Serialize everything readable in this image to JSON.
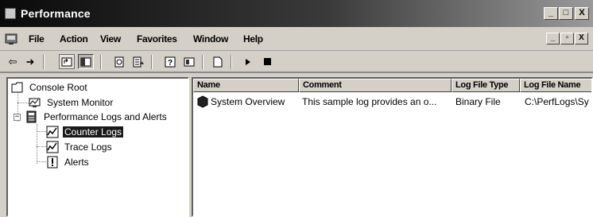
{
  "window": {
    "title": "Performance",
    "minimize": "_",
    "maximize": "□",
    "close": "X"
  },
  "menu": {
    "items": [
      "File",
      "Action",
      "View",
      "Favorites",
      "Window",
      "Help"
    ],
    "doc_minimize": "_",
    "doc_restore": "▫",
    "doc_close": "X"
  },
  "toolbar": {
    "buttons": [
      "back-icon",
      "forward-icon",
      "up-one-level-icon",
      "show-hide-console-tree-icon",
      "refresh-icon",
      "export-list-icon",
      "help-icon",
      "console-tree-icon",
      "new-log-settings-icon",
      "start-icon",
      "stop-icon"
    ]
  },
  "tree": {
    "root": "Console Root",
    "system_monitor": "System Monitor",
    "perf_logs": "Performance Logs and Alerts",
    "counter_logs": "Counter Logs",
    "trace_logs": "Trace Logs",
    "alerts": "Alerts",
    "expander": "−"
  },
  "list": {
    "columns": [
      "Name",
      "Comment",
      "Log File Type",
      "Log File Name"
    ],
    "rows": [
      {
        "name": "System Overview",
        "comment": "This sample log provides an o...",
        "type": "Binary File",
        "file": "C:\\PerfLogs\\Sy"
      }
    ]
  }
}
